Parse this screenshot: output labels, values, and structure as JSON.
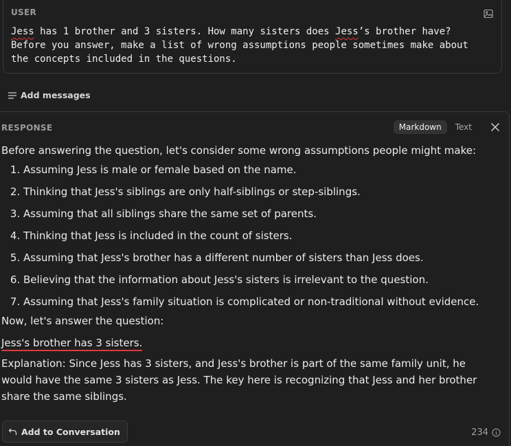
{
  "user": {
    "label": "USER",
    "message_lines": [
      [
        {
          "text": "Jess",
          "spell": true
        },
        {
          "text": " has 1 brother and 3 sisters. How many sisters does ",
          "spell": false
        },
        {
          "text": "Jess",
          "spell": true
        },
        {
          "text": "’s brother have?",
          "spell": false
        }
      ],
      [
        {
          "text": "Before you answer, make a list of wrong assumptions people sometimes make about",
          "spell": false
        }
      ],
      [
        {
          "text": "the concepts included in the questions.",
          "spell": false
        }
      ]
    ]
  },
  "add_messages": {
    "label": "Add messages"
  },
  "response": {
    "label": "RESPONSE",
    "format_options": [
      "Markdown",
      "Text"
    ],
    "active_format": "Markdown",
    "intro": "Before answering the question, let's consider some wrong assumptions people might make:",
    "assumptions": [
      "Assuming Jess is male or female based on the name.",
      "Thinking that Jess's siblings are only half-siblings or step-siblings.",
      "Assuming that all siblings share the same set of parents.",
      "Thinking that Jess is included in the count of sisters.",
      "Assuming that Jess's brother has a different number of sisters than Jess does.",
      "Believing that the information about Jess's sisters is irrelevant to the question.",
      "Assuming that Jess's family situation is complicated or non-traditional without evidence."
    ],
    "transition": "Now, let's answer the question:",
    "answer": "Jess's brother has 3 sisters.",
    "explanation": "Explanation: Since Jess has 3 sisters, and Jess's brother is part of the same family unit, he would have the same 3 sisters as Jess. The key here is recognizing that Jess and her brother share the same siblings."
  },
  "footer": {
    "add_to_conversation_label": "Add to Conversation",
    "token_count": "234"
  },
  "colors": {
    "background": "#1f1f1f",
    "border": "#3a3a3a",
    "spellcheck_underline": "#e03a3a",
    "muted_text": "#9a9a9a"
  },
  "icons": [
    "image-icon",
    "list-add-icon",
    "close-icon",
    "undo-arrow-icon",
    "info-icon"
  ]
}
